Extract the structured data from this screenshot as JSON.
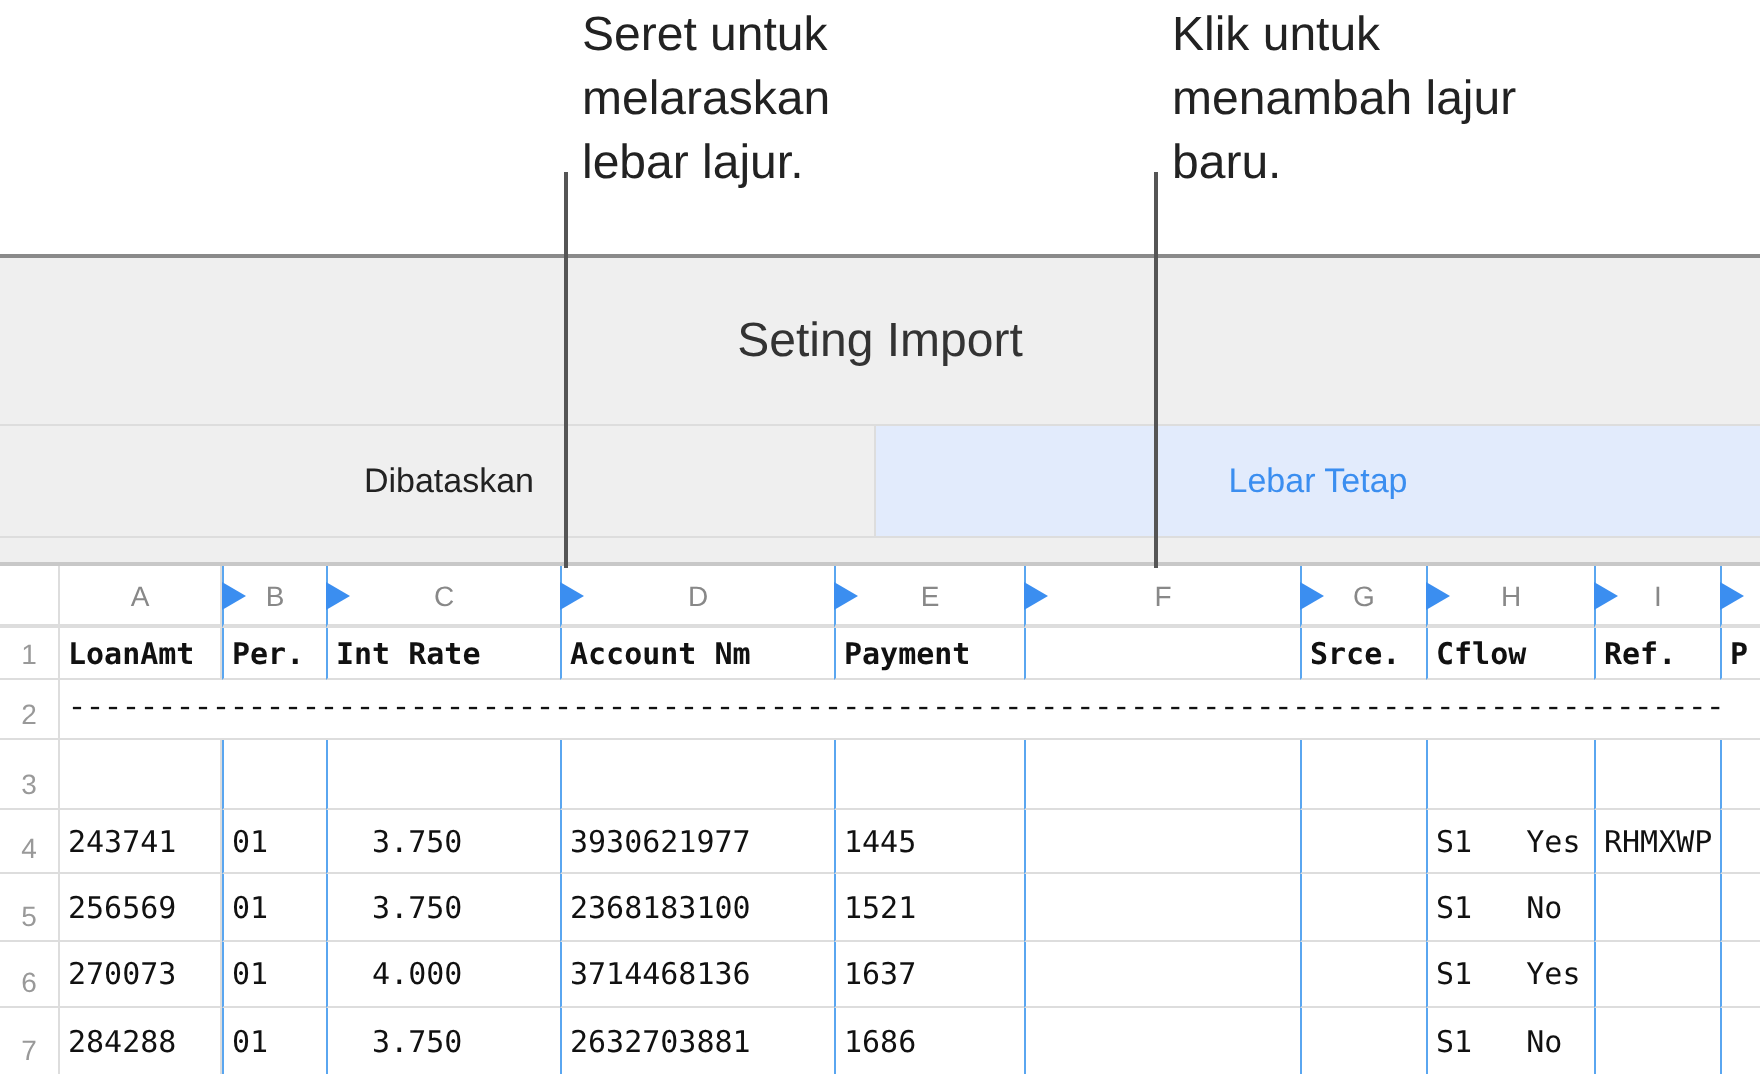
{
  "callouts": [
    {
      "text": "Seret untuk melaraskan lebar lajur."
    },
    {
      "text": "Klik untuk menambah lajur baru."
    }
  ],
  "dialog": {
    "title": "Seting Import"
  },
  "tabs": [
    {
      "label": "Dibataskan",
      "selected": false
    },
    {
      "label": "Lebar Tetap",
      "selected": true
    }
  ],
  "table": {
    "columns": [
      {
        "label": "A",
        "break_marker": false
      },
      {
        "label": "B",
        "break_marker": true
      },
      {
        "label": "C",
        "break_marker": true
      },
      {
        "label": "D",
        "break_marker": true
      },
      {
        "label": "E",
        "break_marker": true
      },
      {
        "label": "F",
        "break_marker": true
      },
      {
        "label": "G",
        "break_marker": true
      },
      {
        "label": "H",
        "break_marker": true
      },
      {
        "label": "I",
        "break_marker": true
      },
      {
        "break_marker": true
      }
    ],
    "rows": [
      {
        "number": "1",
        "kind": "header",
        "cells": [
          "LoanAmt",
          "Per.",
          "Int Rate",
          "Account Nm",
          "Payment",
          "",
          "Srce.",
          "Cflow",
          "Ref.",
          "P"
        ]
      },
      {
        "number": "2",
        "kind": "rule",
        "text": "--------------------------------------------------------------------------------------------"
      },
      {
        "number": "3",
        "kind": "data",
        "cells": [
          "",
          "",
          "",
          "",
          "",
          "",
          "",
          "",
          "",
          ""
        ]
      },
      {
        "number": "4",
        "kind": "data",
        "cells": [
          "243741",
          "01",
          "  3.750",
          "3930621977",
          "1445",
          "",
          "",
          "S1   Yes",
          "RHMXWP",
          ""
        ]
      },
      {
        "number": "5",
        "kind": "data",
        "cells": [
          "256569",
          "01",
          "  3.750",
          "2368183100",
          "1521",
          "",
          "",
          "S1   No",
          "",
          ""
        ]
      },
      {
        "number": "6",
        "kind": "data",
        "cells": [
          "270073",
          "01",
          "  4.000",
          "3714468136",
          "1637",
          "",
          "",
          "S1   Yes",
          "",
          ""
        ]
      },
      {
        "number": "7",
        "kind": "data",
        "cells": [
          "284288",
          "01",
          "  3.750",
          "2632703881",
          "1686",
          "",
          "",
          "S1   No",
          "",
          ""
        ]
      }
    ]
  }
}
